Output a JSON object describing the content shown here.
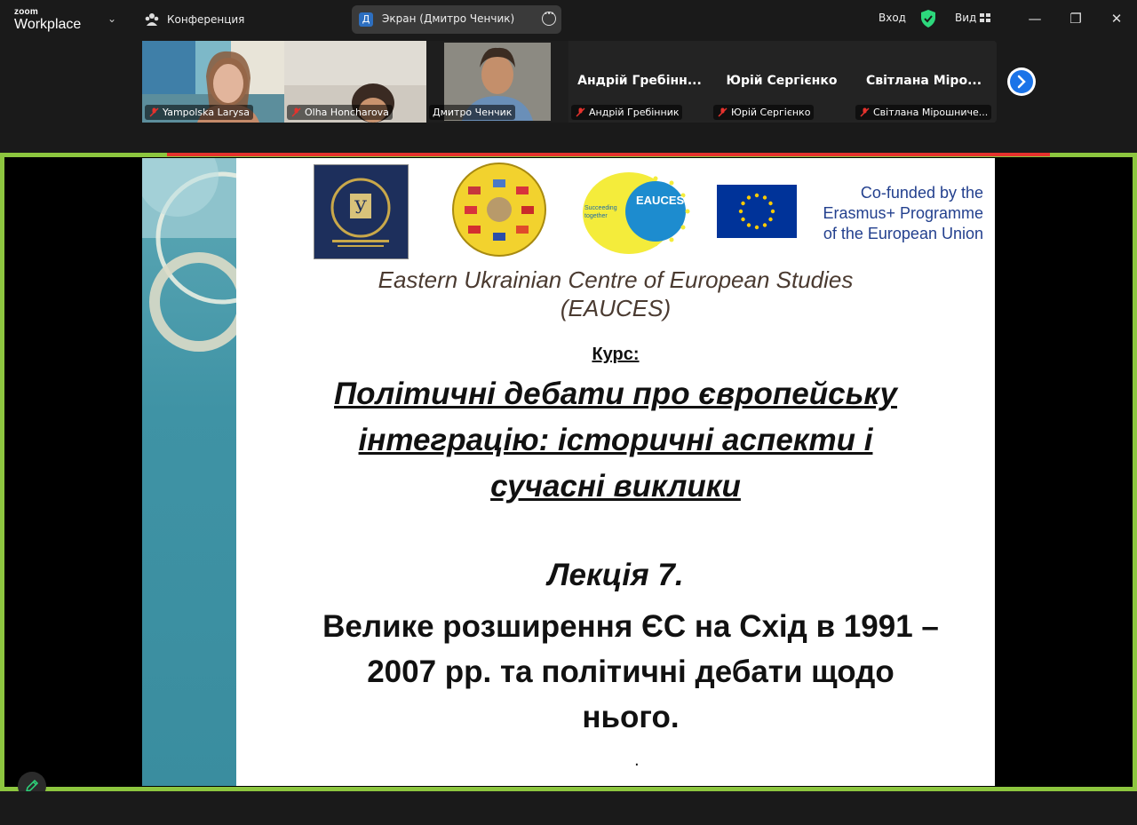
{
  "app": {
    "logo_small": "zoom",
    "logo_big": "Workplace"
  },
  "titlebar": {
    "meeting_label": "Конференция",
    "screen_share_initial": "Д",
    "screen_share_label": "Экран (Дмитро Ченчик)",
    "enter_label": "Вход",
    "view_label": "Вид",
    "accent_color": "#2dd87c",
    "share_border_color": "#8dc63f"
  },
  "participants": [
    {
      "name": "Yampolska Larysa",
      "video": true,
      "muted": true
    },
    {
      "name": "Olha Honcharova",
      "video": true,
      "muted": true
    },
    {
      "name": "Дмитро Ченчик",
      "video": true,
      "muted": false,
      "active": true
    },
    {
      "name": "Андрій Гребінник",
      "display": "Андрій Гребінн...",
      "video": false,
      "muted": true
    },
    {
      "name": "Юрій Сергієнко",
      "display": "Юрій Сергієнко",
      "video": false,
      "muted": true
    },
    {
      "name": "Світлана Мірошниче...",
      "display": "Світлана Міро...",
      "video": false,
      "muted": true
    }
  ],
  "slide": {
    "cofunded_line1": "Co-funded by the",
    "cofunded_line2": "Erasmus+ Programme",
    "cofunded_line3": "of the European Union",
    "eauces_logo_text": "EAUCES",
    "eauces_tagline": "Succeeding together",
    "centre_line1": "Eastern Ukrainian Centre of European Studies",
    "centre_line2": "(EAUCES)",
    "course_label": "Курс:",
    "course_title_line1": "Політичні дебати про європейську",
    "course_title_line2": "інтеграцію: історичні аспекти і",
    "course_title_line3": "сучасні виклики",
    "lecture_number": "Лекція 7.",
    "lecture_title_line1": "Велике розширення ЄС на Схід в 1991 –",
    "lecture_title_line2": "2007 рр. та політичні дебати щодо",
    "lecture_title_line3": "нього.",
    "trailing_dot": "."
  }
}
